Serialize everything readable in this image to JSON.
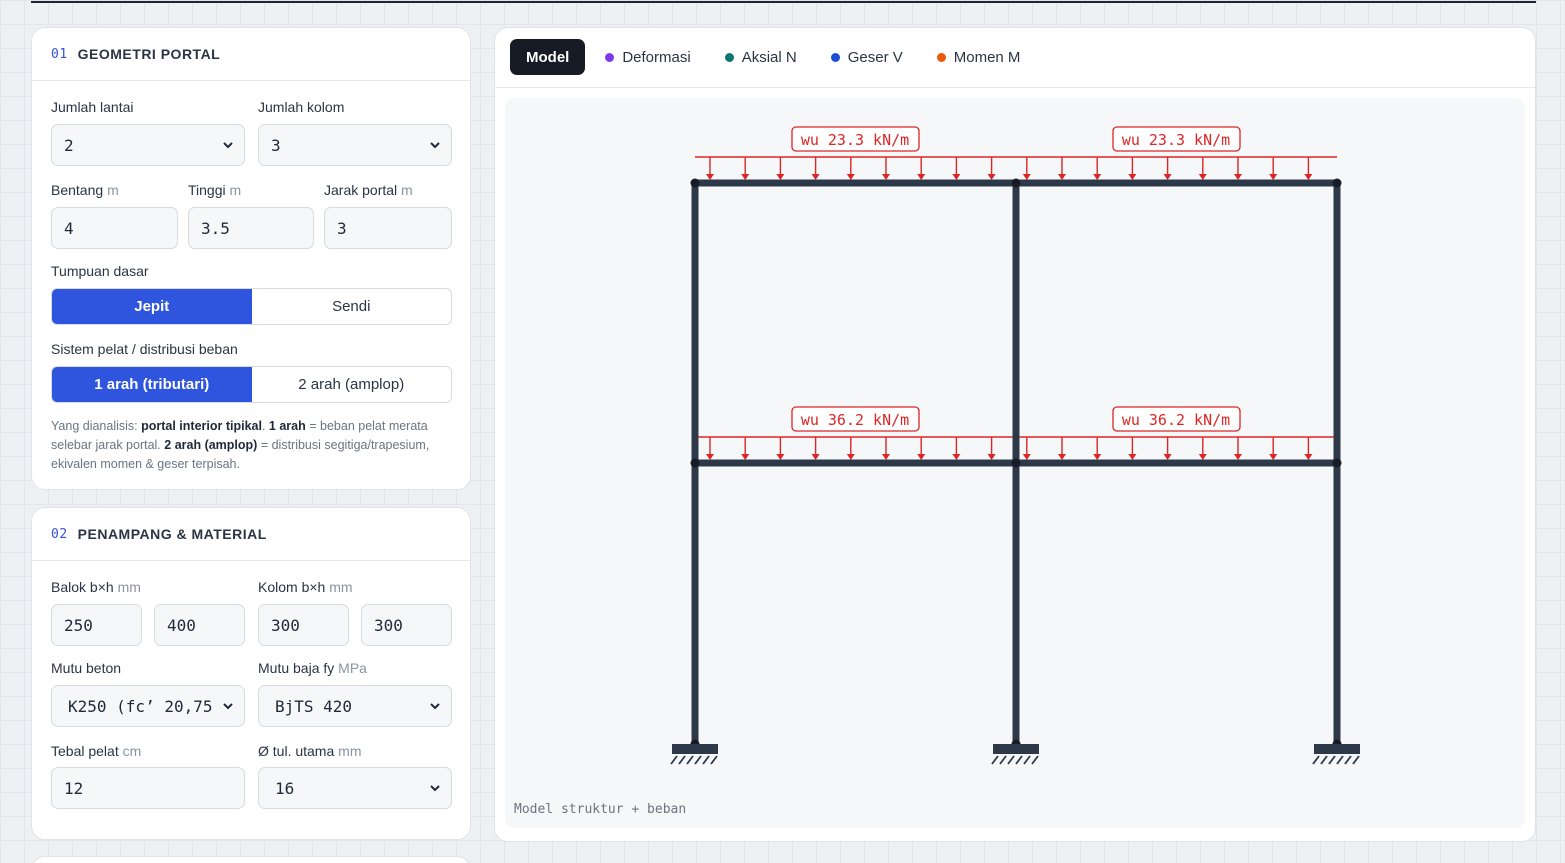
{
  "geometry": {
    "num": "01",
    "title": "GEOMETRI PORTAL",
    "floors_label": "Jumlah lantai",
    "floors_value": "2",
    "cols_label": "Jumlah kolom",
    "cols_value": "3",
    "span_label": "Bentang",
    "span_unit": "m",
    "span_value": "4",
    "height_label": "Tinggi",
    "height_unit": "m",
    "height_value": "3.5",
    "spacing_label": "Jarak portal",
    "spacing_unit": "m",
    "spacing_value": "3",
    "support_label": "Tumpuan dasar",
    "support_options": [
      "Jepit",
      "Sendi"
    ],
    "support_selected": "Jepit",
    "slab_label": "Sistem pelat / distribusi beban",
    "slab_options": [
      "1 arah (tributari)",
      "2 arah (amplop)"
    ],
    "slab_selected": "1 arah (tributari)",
    "note": {
      "p1": "Yang dianalisis: ",
      "b1": "portal interior tipikal",
      "p2": ". ",
      "b2": "1 arah",
      "p3": " = beban pelat merata selebar jarak portal. ",
      "b3": "2 arah (amplop)",
      "p4": " = distribusi segitiga/trapesium, ekivalen momen & geser terpisah."
    }
  },
  "section": {
    "num": "02",
    "title": "PENAMPANG & MATERIAL",
    "beam_label": "Balok b×h",
    "beam_unit": "mm",
    "beam_b": "250",
    "beam_h": "400",
    "col_label": "Kolom b×h",
    "col_unit": "mm",
    "col_b": "300",
    "col_h": "300",
    "concrete_label": "Mutu beton",
    "concrete_value": "K250 (fc’ 20,75",
    "steel_label": "Mutu baja fy",
    "steel_unit": "MPa",
    "steel_value": "BjTS 420",
    "slab_label": "Tebal pelat",
    "slab_unit": "cm",
    "slab_value": "12",
    "bar_label": "Ø tul. utama",
    "bar_unit": "mm",
    "bar_value": "16"
  },
  "viewer": {
    "tabs": [
      {
        "label": "Model",
        "active": true
      },
      {
        "label": "Deformasi",
        "color": "#7c3aed"
      },
      {
        "label": "Aksial N",
        "color": "#0f766e"
      },
      {
        "label": "Geser V",
        "color": "#1d4ed8"
      },
      {
        "label": "Momen M",
        "color": "#ea580c"
      }
    ],
    "caption": "Model struktur + beban",
    "loads": {
      "roof": "wu 23.3 kN/m",
      "floor": "wu 36.2 kN/m"
    },
    "colors": {
      "member": "#2d3848",
      "load": "#dc2626"
    }
  }
}
